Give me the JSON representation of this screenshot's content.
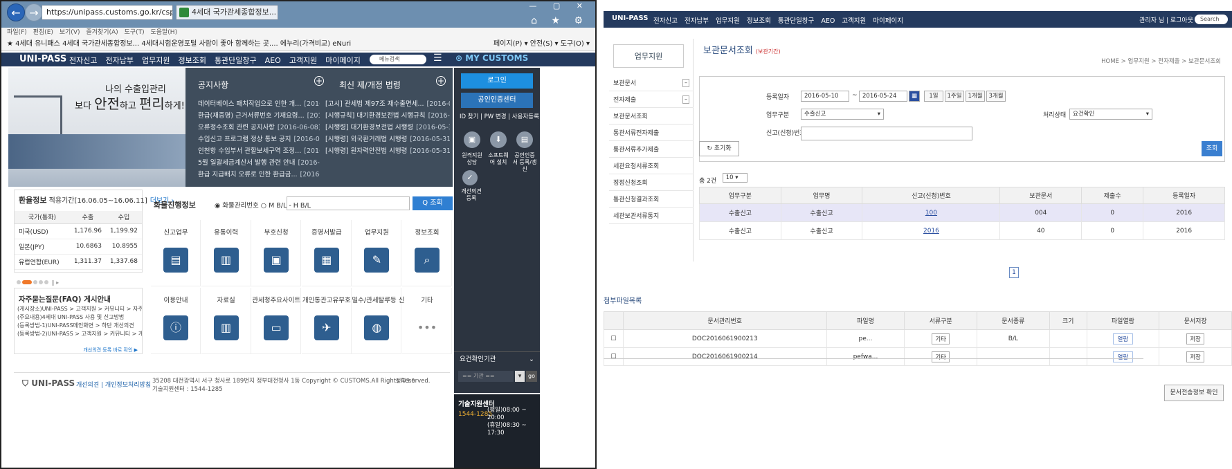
{
  "browser": {
    "url": "https://unipass.customs.go.kr/csp/index.do",
    "tab_title": "4세대 국가관세종합정보...",
    "menu": "파일(F) 편집(E) 보기(V) 즐겨찾기(A) 도구(T) 도움말(H)",
    "favorites": "★ 4세대 유니패스  4세대 국가관세종합정보...  4세대시험운영포털  사람이 좋아 함께하는 곳....  에누리(가격비교) eNuri",
    "toolbar_right": "페이지(P) ▾  안전(S) ▾  도구(O) ▾",
    "win_controls": "—  ▢  ✕"
  },
  "site": {
    "logo": "UNI-PASS",
    "nav": [
      "전자신고",
      "전자납부",
      "업무지원",
      "정보조회",
      "통관단일창구",
      "AEO",
      "고객지원",
      "마이페이지"
    ],
    "menu_search": "메뉴검색",
    "my_customs": "MY CUSTOMS"
  },
  "hero": {
    "line1": "나의 수출입관리",
    "line2_pre": "보다 ",
    "line2_big1": "안전",
    "line2_mid": "하고 ",
    "line2_big2": "편리",
    "line2_post": "하게!"
  },
  "notices": {
    "title": "공지사항",
    "items": [
      {
        "text": "데이터베이스 패치작업으로 인한 개...",
        "date": "[2016-06-09]"
      },
      {
        "text": "환급(재증명) 근거서류번호 기재요령...",
        "date": "[2016-06-09]"
      },
      {
        "text": "오류정수조회 관련 공지사항",
        "date": "[2016-06-08]"
      },
      {
        "text": "수입신고 프로그램 정상 통보 공지",
        "date": "[2016-06-07]"
      },
      {
        "text": "인천항 수입부서 관할보세구역 조정...",
        "date": "[2016-06-08]"
      },
      {
        "text": "5월 일괄세금계산서 발행 관련 안내",
        "date": "[2016-06-03]"
      },
      {
        "text": "환급 지급배치 오류로 인한 환급금...",
        "date": "[2016-06-03]"
      }
    ]
  },
  "laws": {
    "title": "최신 제/개정 법령",
    "items": [
      {
        "text": "[고시] 관세법 제97조 재수출면세...",
        "date": "[2016-06-03]"
      },
      {
        "text": "[시행규칙] 대기환경보전법 시행규칙",
        "date": "[2016-06-02]"
      },
      {
        "text": "[시행령] 대기환경보전법 시행령",
        "date": "[2016-05-31]"
      },
      {
        "text": "[시행령] 외국환거래법 시행령",
        "date": "[2016-05-31]"
      },
      {
        "text": "[시행령] 원자력안전법 시행령",
        "date": "[2016-05-31]"
      }
    ]
  },
  "side": {
    "login": "로그인",
    "cert": "공인인증센터",
    "idpw": "ID 찾기 | PW 변경 | 사용자등록",
    "icons": [
      {
        "label": "원격지원 상담"
      },
      {
        "label": "소프트웨어 설치"
      },
      {
        "label": "공인인증서 등록/갱신"
      }
    ],
    "suggest": "개선의견 등록",
    "agency_title": "요건확인기관",
    "agency_select": "== 기관 ==",
    "go": "go",
    "tech_title": "기술지원센터",
    "tech_phone": "1544-1285",
    "tech_hours1": "(평일)08:00 ~ 20:00",
    "tech_hours2": "(휴일)08:30 ~ 17:30"
  },
  "exchange": {
    "title": "환율정보",
    "period": "적용기간[16.06.05~16.06.11]",
    "more": "더보기 ›",
    "headers": [
      "국가(통화)",
      "수출",
      "수입"
    ],
    "rows": [
      {
        "country": "미국(USD)",
        "export": "1,176.96",
        "import": "1,199.92"
      },
      {
        "country": "일본(JPY)",
        "export": "10.6863",
        "import": "10.8955"
      },
      {
        "country": "유럽연합(EUR)",
        "export": "1,311.37",
        "import": "1,337.68"
      }
    ]
  },
  "faq": {
    "title": "자주묻는질문(FAQ) 게시안내",
    "items": [
      "(게시장소)UNI-PASS > 고객지원 > 커뮤니티 > 자주묻는질문",
      "(주요내용)4세대 UNI-PASS 사용 및 신고방법",
      "(등록방법-1)UNI-PASS메인화면 > 하단 개선의견",
      "(등록방법-2)UNI-PASS > 고객지원 > 커뮤니티 > 개선의견"
    ],
    "more": "개선의견 등록 바로 확인 ▶"
  },
  "tracking": {
    "label": "화물진행정보",
    "options": "◉ 화물관리번호  ○ M B/L - H B/L",
    "button": "Q 조회"
  },
  "grid": [
    {
      "label": "신고업무",
      "icon": "▤"
    },
    {
      "label": "유통이력",
      "icon": "▥"
    },
    {
      "label": "부호신청",
      "icon": "▣"
    },
    {
      "label": "증명서발급",
      "icon": "▦"
    },
    {
      "label": "업무지원",
      "icon": "✎"
    },
    {
      "label": "정보조회",
      "icon": "⌕"
    },
    {
      "label": "이용안내",
      "icon": "ⓘ"
    },
    {
      "label": "자료실",
      "icon": "▥"
    },
    {
      "label": "관세청주요사이트",
      "icon": "▭"
    },
    {
      "label": "개인통관고유부호",
      "icon": "✈"
    },
    {
      "label": "밀수/관세탈루등 신",
      "icon": "◍"
    },
    {
      "label": "기타",
      "icon": "•••"
    }
  ],
  "footer": {
    "logo": "UNI-PASS",
    "links": "개선의견 | 개인정보처리방침",
    "address": "35208 대전광역시 서구 청사로 189번지 정부대전청사 1동  Copyright © CUSTOMS.All Rights Reserved.",
    "support": "기술지원센터 : 1544-1285",
    "gov": "정부3.0"
  },
  "app": {
    "logo": "UNI-PASS",
    "nav": [
      "전자신고",
      "전자납부",
      "업무지원",
      "정보조회",
      "통관단일창구",
      "AEO",
      "고객지원",
      "마이페이지"
    ],
    "nav_right": "관리자 님 | 로그아웃",
    "search": "Search",
    "side_title": "업무지원",
    "side_items": [
      "보관문서",
      "전자제출",
      "보관문서조회",
      "통관서류전자제출",
      "통관서류추가제출",
      "세관요청서류조회",
      "정정신청조회",
      "통관신청결과조회",
      "세관보관서류통지"
    ],
    "page_title": "보관문서조회",
    "page_note": "(보관기간)",
    "breadcrumb": "HOME > 업무지원 > 전자제출 > 보관문서조회",
    "form": {
      "period_label": "등록일자",
      "date_from": "2016-05-10",
      "date_to": "2016-05-24",
      "periods": [
        "1일",
        "1주일",
        "1개월",
        "3개월"
      ],
      "type_label": "업무구분",
      "type_value": "수출신고",
      "status_label": "처리상태",
      "status_value": "요건확인",
      "docno_label": "신고(신청)번호",
      "reset": "초기화",
      "query": "조회"
    },
    "result_count": "총 2건",
    "page_size": "10",
    "table1": {
      "headers": [
        "업무구분",
        "업무명",
        "신고(신청)번호",
        "보관문서",
        "제출수",
        "등록일자"
      ],
      "rows": [
        {
          "c1": "수출신고",
          "c2": "수출신고",
          "c3": "100",
          "c4": "004",
          "c5": "0",
          "c6": "2016"
        },
        {
          "c1": "수출신고",
          "c2": "수출신고",
          "c3": "2016",
          "c4": "40",
          "c5": "0",
          "c6": "2016"
        }
      ]
    },
    "pager": "1",
    "sub_title": "첨부파일목록",
    "table2": {
      "headers": [
        "",
        "문서관리번호",
        "파일명",
        "서류구분",
        "문서종류",
        "크기",
        "파일열람",
        "문서저장"
      ],
      "rows": [
        {
          "id": "DOC2016061900213",
          "file": "pe...",
          "kind": "기타",
          "type": "B/L",
          "size": "",
          "view": "열람",
          "save": "저장"
        },
        {
          "id": "DOC2016061900214",
          "file": "pefwa...",
          "kind": "기타",
          "type": "",
          "size": "",
          "view": "열람",
          "save": "저장"
        }
      ]
    },
    "bottom_btn": "문서전송정보 확인"
  }
}
